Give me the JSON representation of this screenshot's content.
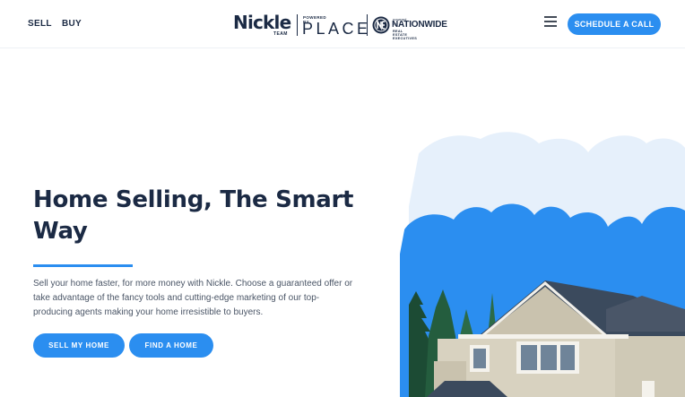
{
  "nav": {
    "sell": "SELL",
    "buy": "BUY"
  },
  "logo": {
    "nickle": "Nickle",
    "team": "TEAM",
    "powered_by": "POWERED BY",
    "place": "PLACE",
    "ne_powered": "powered by",
    "ne_name": "NATIONWIDE",
    "ne_sub": "REAL ESTATE EXECUTIVES"
  },
  "header": {
    "cta": "SCHEDULE A CALL"
  },
  "hero": {
    "title": "Home Selling, The Smart Way",
    "description": "Sell your home faster, for more money with Nickle. Choose a guaranteed offer or take advantage of the fancy tools and cutting-edge marketing of our top-producing agents making your home irresistible to buyers.",
    "sell_button": "SELL MY HOME",
    "find_button": "FIND A HOME"
  },
  "colors": {
    "accent": "#2b8ef0",
    "text": "#1b2a44",
    "cloud_light": "#e8f1fb",
    "cloud_blue": "#2b8ef0"
  }
}
